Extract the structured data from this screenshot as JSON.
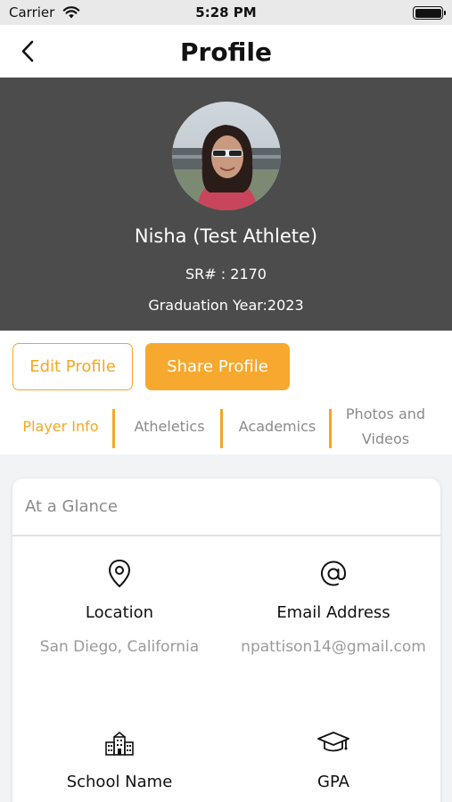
{
  "status_bar": {
    "carrier": "Carrier",
    "time": "5:28 PM"
  },
  "nav": {
    "title": "Profile",
    "back_icon": "chevron-left-icon"
  },
  "profile": {
    "name": "Nisha (Test Athlete)",
    "sr": "SR# : 2170",
    "graduation": "Graduation Year:2023"
  },
  "actions": {
    "edit_label": "Edit Profile",
    "share_label": "Share Profile"
  },
  "tabs": [
    {
      "label": "Player Info",
      "active": true
    },
    {
      "label": "Atheletics",
      "active": false
    },
    {
      "label": "Academics",
      "active": false
    },
    {
      "label": "Photos and Videos",
      "active": false
    }
  ],
  "glance": {
    "title": "At a Glance",
    "items": [
      {
        "icon": "location-pin-icon",
        "label": "Location",
        "value": "San Diego, California"
      },
      {
        "icon": "at-sign-icon",
        "label": "Email Address",
        "value": "npattison14@gmail.com"
      },
      {
        "icon": "school-building-icon",
        "label": "School Name",
        "value": ""
      },
      {
        "icon": "graduation-cap-icon",
        "label": "GPA",
        "value": ""
      }
    ]
  },
  "colors": {
    "accent": "#f5a623",
    "header_bg": "#4c4c4c"
  }
}
